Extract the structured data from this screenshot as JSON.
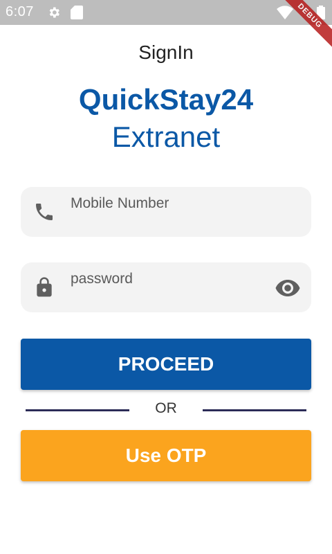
{
  "status_bar": {
    "time": "6:07",
    "debug_label": "DEBUG"
  },
  "page": {
    "heading": "SignIn",
    "brand_name": "QuickStay24",
    "brand_sub": "Extranet"
  },
  "form": {
    "mobile": {
      "label": "Mobile Number",
      "icon": "phone-icon"
    },
    "password": {
      "label": "password",
      "icon": "lock-icon",
      "toggle_icon": "eye-icon"
    },
    "proceed_label": "PROCEED",
    "or_label": "OR",
    "otp_label": "Use OTP"
  },
  "colors": {
    "brand_blue": "#0b58a6",
    "otp_orange": "#fba41e",
    "field_bg": "#f3f3f3",
    "divider": "#2c2c57"
  }
}
